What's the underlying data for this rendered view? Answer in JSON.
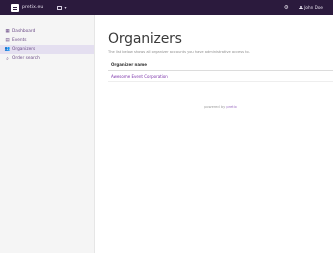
{
  "topbar": {
    "brand": "pretix.eu",
    "user": "John Doe"
  },
  "sidebar": {
    "items": [
      {
        "label": "Dashboard",
        "icon": "dashboard-icon",
        "active": false
      },
      {
        "label": "Events",
        "icon": "calendar-icon",
        "active": false
      },
      {
        "label": "Organizers",
        "icon": "users-icon",
        "active": true
      },
      {
        "label": "Order search",
        "icon": "search-icon",
        "active": false
      }
    ]
  },
  "main": {
    "title": "Organizers",
    "subtitle": "The list below shows all organizer accounts you have administrative access to.",
    "table": {
      "header": "Organizer name",
      "rows": [
        "Awesome Event Corporation"
      ]
    },
    "footer_prefix": "powered by",
    "footer_link": "pretix"
  },
  "colors": {
    "topbar": "#2b1a3d",
    "accent": "#7a2fa8",
    "sidebar_active": "#e4dff0"
  }
}
